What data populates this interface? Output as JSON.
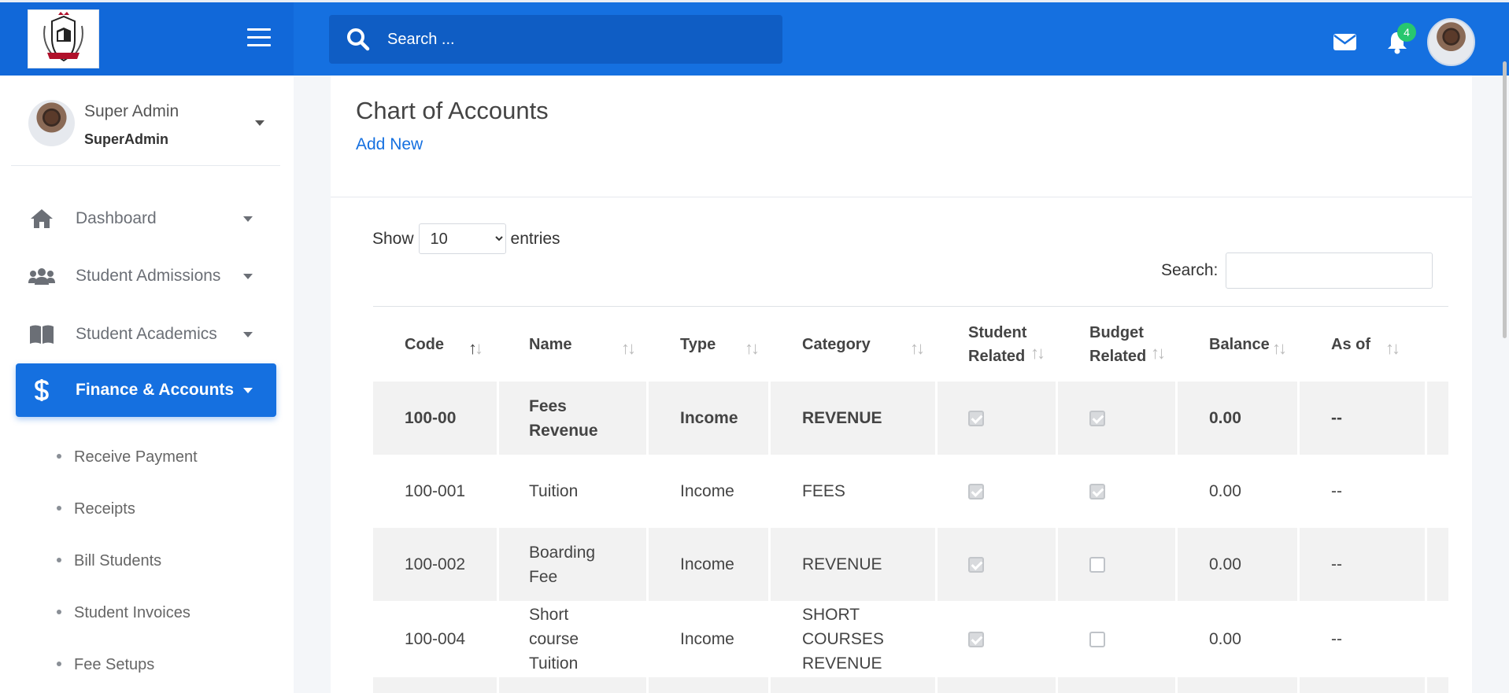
{
  "header": {
    "search_placeholder": "Search ...",
    "notification_count": "4"
  },
  "sidebar": {
    "user_name": "Super Admin",
    "user_role": "SuperAdmin",
    "nav": [
      {
        "label": "Dashboard",
        "icon": "home-icon"
      },
      {
        "label": "Student Admissions",
        "icon": "users-icon"
      },
      {
        "label": "Student Academics",
        "icon": "book-icon"
      },
      {
        "label": "Finance & Accounts",
        "icon": "dollar-icon",
        "active": true
      }
    ],
    "sub_items": [
      "Receive Payment",
      "Receipts",
      "Bill Students",
      "Student Invoices",
      "Fee Setups"
    ]
  },
  "page": {
    "title": "Chart of Accounts",
    "add_new": "Add New",
    "show_label": "Show",
    "entries_value": "10",
    "entries_label": "entries",
    "search_label": "Search:"
  },
  "table": {
    "headers": {
      "code": "Code",
      "name": "Name",
      "type": "Type",
      "category": "Category",
      "student_related": "Student Related",
      "budget_related": "Budget Related",
      "balance": "Balance",
      "as_of": "As of"
    },
    "rows": [
      {
        "code": "100-00",
        "name": "Fees Revenue",
        "type": "Income",
        "category": "REVENUE",
        "student_related": true,
        "budget_related": true,
        "balance": "0.00",
        "as_of": "--"
      },
      {
        "code": "100-001",
        "name": "Tuition",
        "type": "Income",
        "category": "FEES",
        "student_related": true,
        "budget_related": true,
        "balance": "0.00",
        "as_of": "--"
      },
      {
        "code": "100-002",
        "name": "Boarding Fee",
        "type": "Income",
        "category": "REVENUE",
        "student_related": true,
        "budget_related": false,
        "balance": "0.00",
        "as_of": "--"
      },
      {
        "code": "100-004",
        "name": "Short course Tuition",
        "type": "Income",
        "category": "SHORT COURSES REVENUE",
        "student_related": true,
        "budget_related": false,
        "balance": "0.00",
        "as_of": "--"
      }
    ]
  }
}
